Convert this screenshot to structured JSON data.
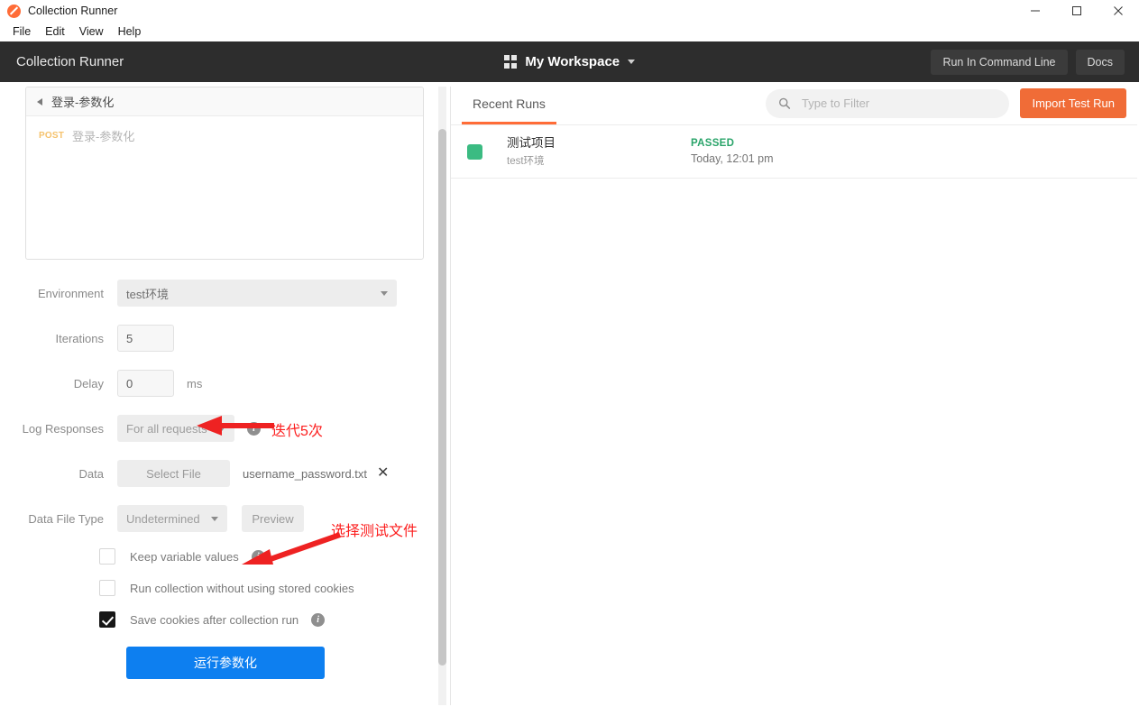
{
  "window": {
    "title": "Collection Runner",
    "logo_icon": "postman-logo-icon",
    "minimize": "—",
    "maximize": "☐",
    "close": "✕"
  },
  "menubar": {
    "items": [
      {
        "label": "File"
      },
      {
        "label": "Edit"
      },
      {
        "label": "View"
      },
      {
        "label": "Help"
      }
    ]
  },
  "appheader": {
    "title": "Collection Runner",
    "workspace_name": "My Workspace",
    "workspace_icon": "grid-icon",
    "workspace_caret": "chevron-down-icon",
    "run_cli_label": "Run In Command Line",
    "docs_label": "Docs"
  },
  "left": {
    "request_box": {
      "collapse_icon": "triangle-left-icon",
      "header_title": "登录-参数化",
      "request_method": "POST",
      "request_name": "登录-参数化"
    },
    "form": {
      "environment_label": "Environment",
      "environment_value": "test环境",
      "iterations_label": "Iterations",
      "iterations_value": "5",
      "delay_label": "Delay",
      "delay_value": "0",
      "delay_unit": "ms",
      "log_responses_label": "Log Responses",
      "log_responses_value": "For all requests",
      "data_label": "Data",
      "select_file_label": "Select File",
      "data_filename": "username_password.txt",
      "clear_file_icon": "close-icon",
      "data_file_type_label": "Data File Type",
      "data_file_type_value": "Undetermined",
      "preview_label": "Preview",
      "info_icon": "info-icon",
      "checkboxes": [
        {
          "label": "Keep variable values",
          "checked": false,
          "has_info": true
        },
        {
          "label": "Run collection without using stored cookies",
          "checked": false,
          "has_info": false
        },
        {
          "label": "Save cookies after collection run",
          "checked": true,
          "has_info": true
        }
      ],
      "run_button_label": "运行参数化"
    },
    "annotations": [
      {
        "text": "迭代5次",
        "color": "#fc1d1d"
      },
      {
        "text": "选择测试文件",
        "color": "#fc1d1d"
      }
    ]
  },
  "right": {
    "tab_label": "Recent Runs",
    "filter_placeholder": "Type to Filter",
    "filter_value": "",
    "search_icon": "search-icon",
    "import_label": "Import Test Run",
    "runs": [
      {
        "swatch_color": "#3bbb82",
        "title": "测试项目",
        "subtitle": "test环境",
        "status": "PASSED",
        "time": "Today, 12:01 pm"
      }
    ]
  },
  "colors": {
    "accent_orange": "#ff6c37",
    "import_orange": "#f06c37",
    "header_dark": "#2d2d2d",
    "run_blue": "#0d7ff0",
    "passed_green": "#2aa46a",
    "annotation_red": "#fc1d1d"
  }
}
